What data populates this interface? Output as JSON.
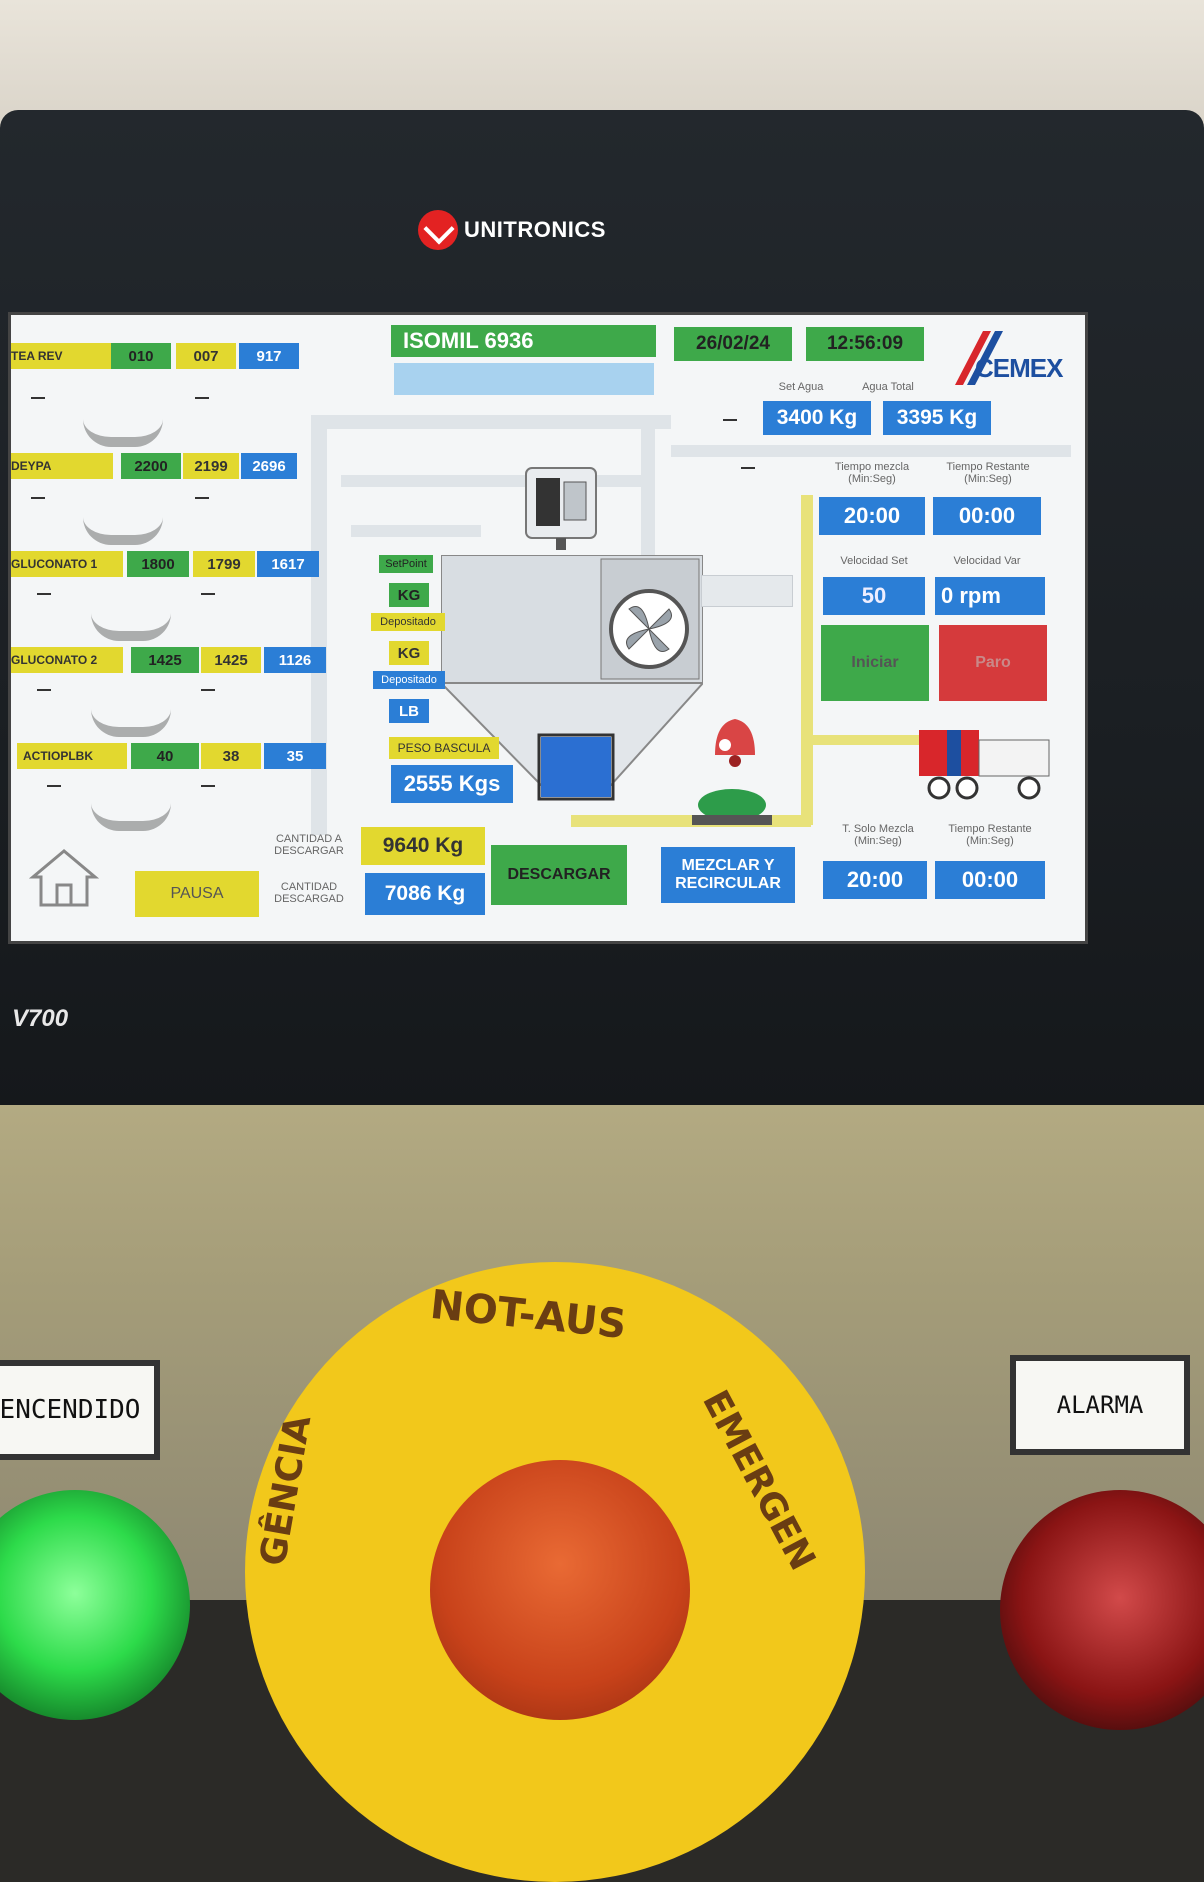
{
  "brand": {
    "name": "UNITRONICS",
    "model": "V700"
  },
  "header": {
    "product": "ISOMIL 6936",
    "date": "26/02/24",
    "time": "12:56:09",
    "company_logo": "CEMEX"
  },
  "ingredients": [
    {
      "name": "TEA REV",
      "set": "010",
      "actual": "007",
      "stock": "917"
    },
    {
      "name": "DEYPA",
      "set": "2200",
      "actual": "2199",
      "stock": "2696"
    },
    {
      "name": "GLUCONATO 1",
      "set": "1800",
      "actual": "1799",
      "stock": "1617"
    },
    {
      "name": "GLUCONATO 2",
      "set": "1425",
      "actual": "1425",
      "stock": "1126"
    },
    {
      "name": "ACTIOPLBK",
      "set": "40",
      "actual": "38",
      "stock": "35"
    }
  ],
  "water": {
    "set_label": "Set Agua",
    "total_label": "Agua Total",
    "set_value": "3400 Kg",
    "total_value": "3395 Kg"
  },
  "mix": {
    "time_label": "Tiempo mezcla\n(Min:Seg)",
    "remaining_label": "Tiempo Restante\n(Min:Seg)",
    "time_value": "20:00",
    "remaining_value": "00:00",
    "speed_set_label": "Velocidad Set",
    "speed_var_label": "Velocidad Var",
    "speed_set_value": "50",
    "speed_var_value": "0 rpm",
    "start_label": "Iniciar",
    "stop_label": "Paro"
  },
  "scale": {
    "setpoint_label": "SetPoint",
    "setpoint_unit": "KG",
    "deposited_label": "Depositado",
    "deposited_unit": "KG",
    "deposited2_label": "Depositado",
    "deposited2_unit": "LB",
    "weight_label": "PESO BASCULA",
    "weight_value": "2555 Kgs"
  },
  "discharge": {
    "to_discharge_label": "CANTIDAD A\nDESCARGAR",
    "to_discharge_value": "9640 Kg",
    "discharged_label": "CANTIDAD\nDESCARGAD",
    "discharged_value": "7086 Kg",
    "pause_label": "PAUSA",
    "discharge_button": "DESCARGAR",
    "mix_recirculate_button": "MEZCLAR Y\nRECIRCULAR"
  },
  "solo_mix": {
    "time_label": "T. Solo Mezcla\n(Min:Seg)",
    "remaining_label": "Tiempo Restante\n(Min:Seg)",
    "time_value": "20:00",
    "remaining_value": "00:00"
  },
  "panel": {
    "power_label": "ENCENDIDO",
    "alarm_label": "ALARMA",
    "estop_top": "NOT-AUS",
    "estop_right": "EMERGEN",
    "estop_left": "GÊNCIA"
  },
  "colors": {
    "yellow": "#e2d82f",
    "green": "#3ea94a",
    "blue": "#2b7ed6",
    "red": "#d53a3c",
    "estop_yellow": "#f2c81b"
  }
}
